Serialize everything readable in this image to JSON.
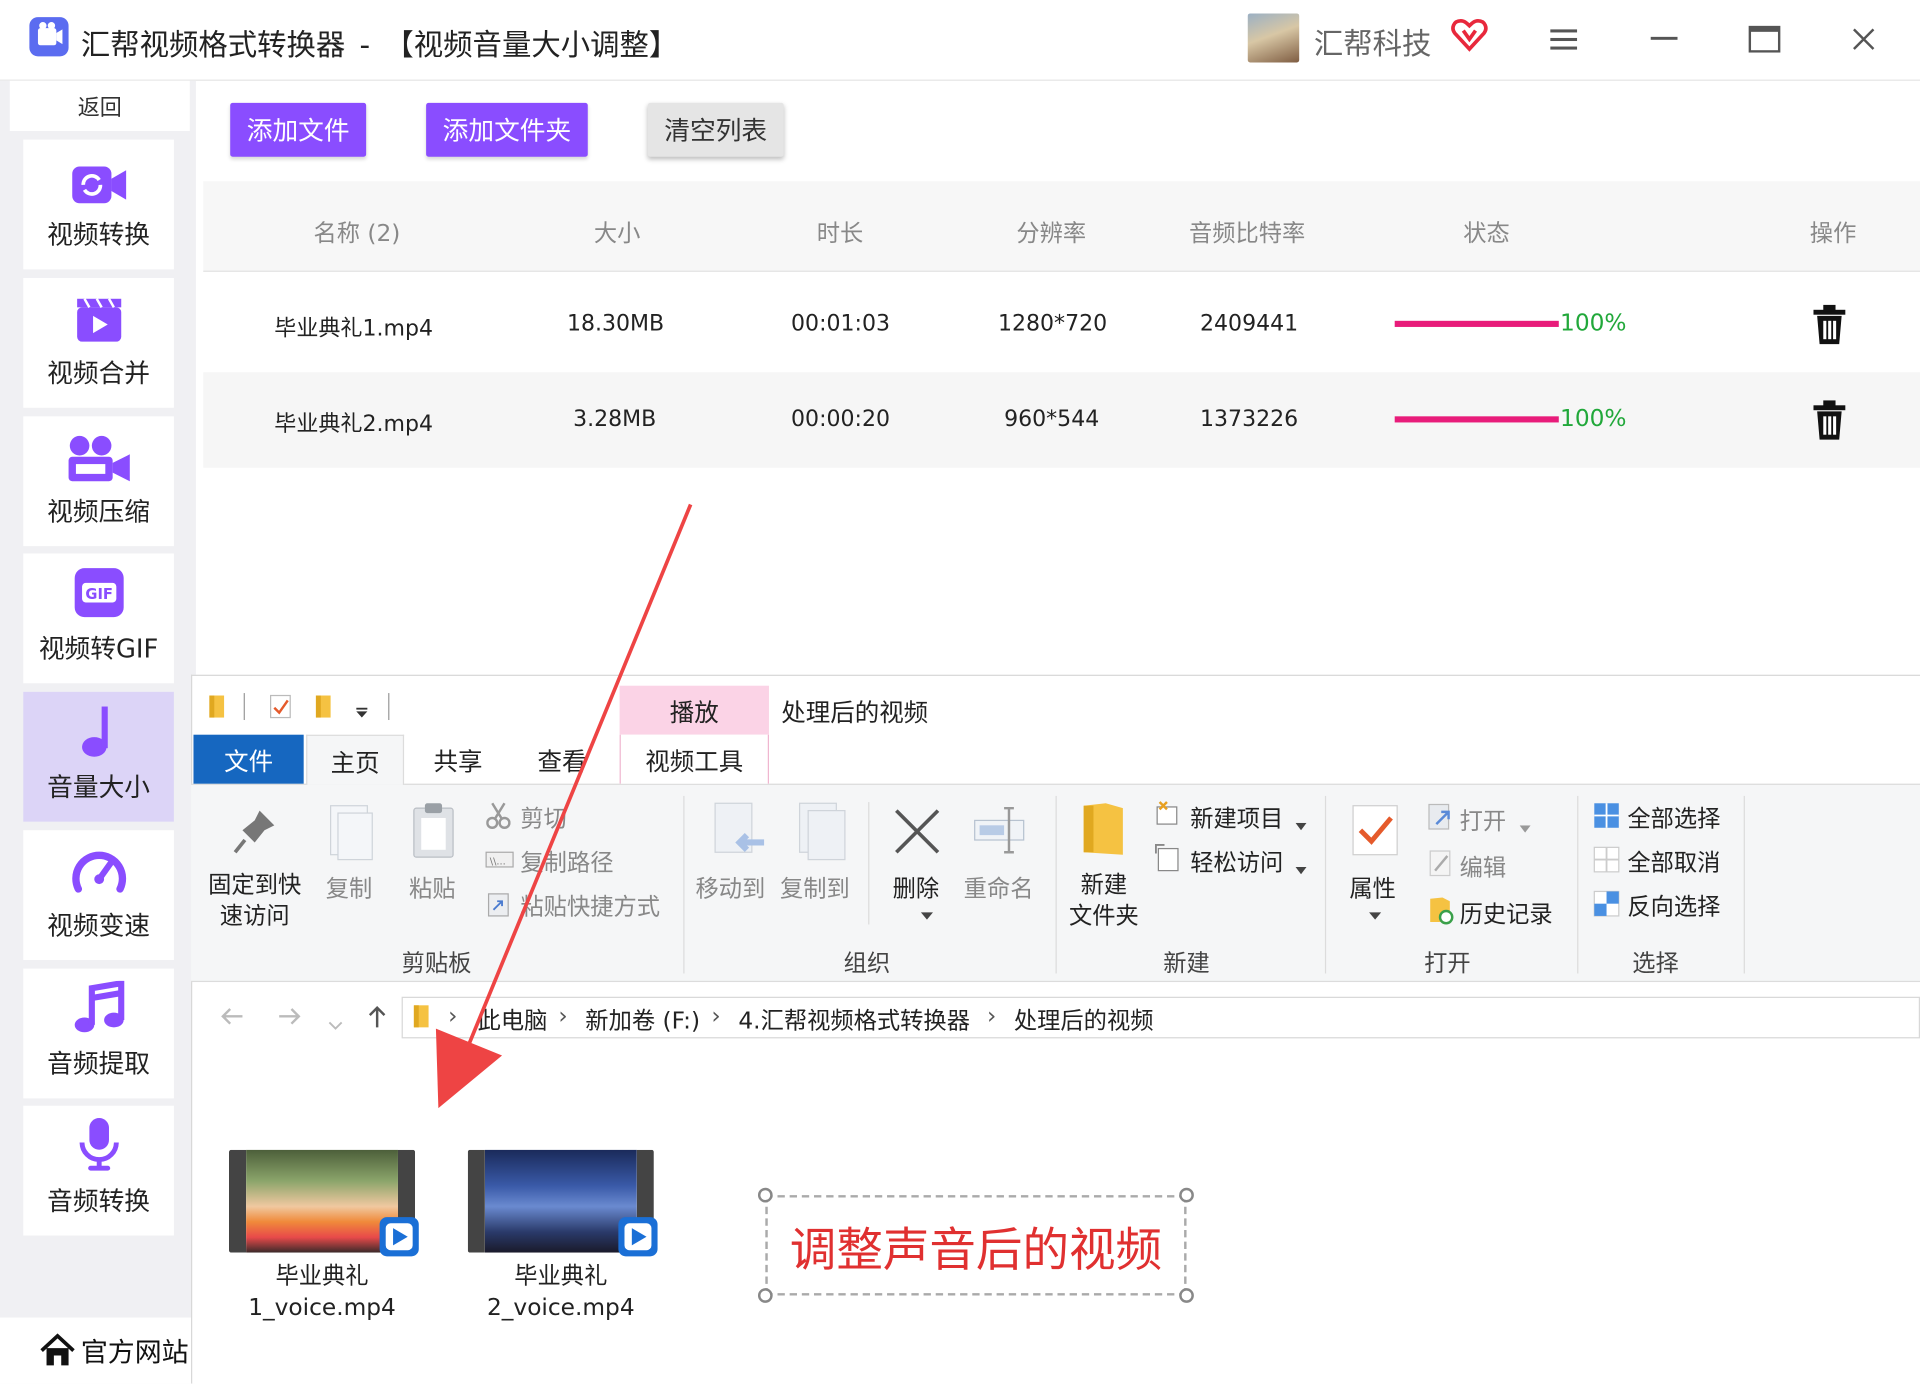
{
  "window": {
    "app_name": "汇帮视频格式转换器",
    "separator": " - ",
    "section_title": "【视频音量大小调整】",
    "company": "汇帮科技"
  },
  "sidebar": {
    "back_label": "返回",
    "items": [
      {
        "label": "视频转换",
        "icon": "video-convert-icon"
      },
      {
        "label": "视频合并",
        "icon": "video-merge-icon"
      },
      {
        "label": "视频压缩",
        "icon": "video-compress-icon"
      },
      {
        "label": "视频转GIF",
        "icon": "gif-icon"
      },
      {
        "label": "音量大小",
        "icon": "music-note-icon",
        "active": true
      },
      {
        "label": "视频变速",
        "icon": "speedometer-icon"
      },
      {
        "label": "音频提取",
        "icon": "audio-extract-icon"
      },
      {
        "label": "音频转换",
        "icon": "microphone-icon"
      }
    ],
    "website_label": "官方网站"
  },
  "toolbar": {
    "add_file": "添加文件",
    "add_folder": "添加文件夹",
    "clear_list": "清空列表"
  },
  "table": {
    "headers": [
      "名称 (2)",
      "大小",
      "时长",
      "分辨率",
      "音频比特率",
      "状态",
      "操作"
    ],
    "rows": [
      {
        "name": "毕业典礼1.mp4",
        "size": "18.30MB",
        "duration": "00:01:03",
        "resolution": "1280*720",
        "bitrate": "2409441",
        "progress": 1.0,
        "progress_label": "100%"
      },
      {
        "name": "毕业典礼2.mp4",
        "size": "3.28MB",
        "duration": "00:00:20",
        "resolution": "960*544",
        "bitrate": "1373226",
        "progress": 1.0,
        "progress_label": "100%"
      }
    ]
  },
  "explorer": {
    "folder_title": "处理后的视频",
    "context_header": "播放",
    "context_tab": "视频工具",
    "tabs": [
      "文件",
      "主页",
      "共享",
      "查看"
    ],
    "clipboard": {
      "pin": "固定到快\n速访问",
      "copy": "复制",
      "paste": "粘贴",
      "cut": "剪切",
      "copy_path": "复制路径",
      "paste_shortcut": "粘贴快捷方式",
      "group": "剪贴板"
    },
    "organize": {
      "move_to": "移动到",
      "copy_to": "复制到",
      "delete": "删除",
      "rename": "重命名",
      "group": "组织"
    },
    "new": {
      "new_folder": "新建\n文件夹",
      "new_item": "新建项目",
      "easy_access": "轻松访问",
      "group": "新建"
    },
    "open": {
      "properties": "属性",
      "open": "打开",
      "edit": "编辑",
      "history": "历史记录",
      "group": "打开"
    },
    "select": {
      "select_all": "全部选择",
      "select_none": "全部取消",
      "invert": "反向选择",
      "group": "选择"
    },
    "breadcrumb": [
      "此电脑",
      "新加卷 (F:)",
      "4.汇帮视频格式转换器",
      "处理后的视频"
    ],
    "files": [
      {
        "name": "毕业典礼\n1_voice.mp4"
      },
      {
        "name": "毕业典礼\n2_voice.mp4"
      }
    ],
    "annotation": "调整声音后的视频"
  },
  "colors": {
    "accent": "#8a4dff",
    "progress": "#e81c7a",
    "percent": "#21a83a",
    "arrow": "#ee4444",
    "file_tab": "#1667c0"
  }
}
